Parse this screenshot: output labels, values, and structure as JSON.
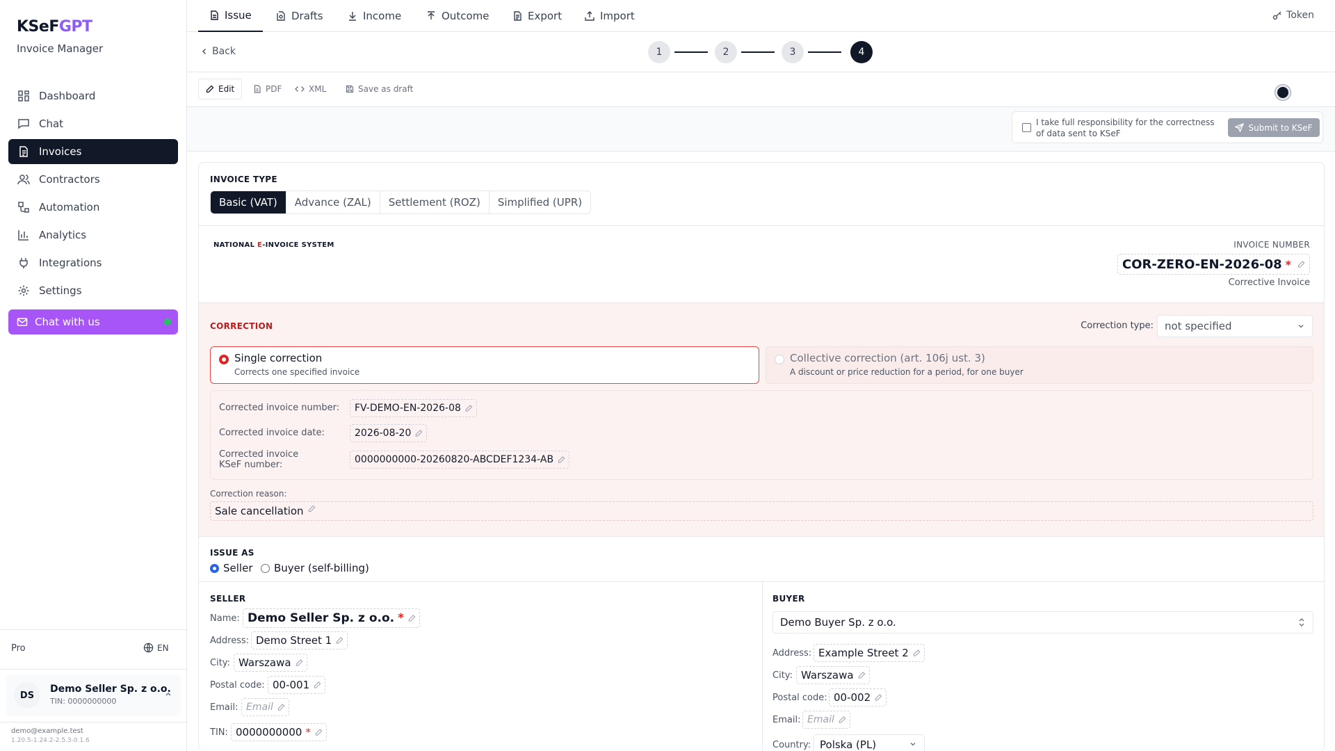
{
  "sidebar": {
    "brand": {
      "prefix": "KSeF",
      "suffix": "GPT"
    },
    "subtitle": "Invoice Manager",
    "nav": [
      {
        "label": "Dashboard",
        "icon": "dashboard-icon"
      },
      {
        "label": "Chat",
        "icon": "chat-icon"
      },
      {
        "label": "Invoices",
        "icon": "invoice-icon"
      },
      {
        "label": "Contractors",
        "icon": "users-icon"
      },
      {
        "label": "Automation",
        "icon": "workflow-icon"
      },
      {
        "label": "Analytics",
        "icon": "bar-chart-icon"
      },
      {
        "label": "Integrations",
        "icon": "plug-icon"
      },
      {
        "label": "Settings",
        "icon": "gear-icon"
      }
    ],
    "active_nav": "Invoices",
    "chat_button": "Chat with us",
    "plan": "Pro",
    "language": "EN",
    "user": {
      "initials": "DS",
      "name": "Demo Seller Sp. z o.o.",
      "tin": "TIN: 0000000000"
    },
    "email": "demo@example.test",
    "version": "1.20.5-1.24.2-2.5.3-0.1.6"
  },
  "topbar": {
    "tabs": [
      {
        "label": "Issue",
        "icon": "file-icon"
      },
      {
        "label": "Drafts",
        "icon": "drafts-icon"
      },
      {
        "label": "Income",
        "icon": "download-icon"
      },
      {
        "label": "Outcome",
        "icon": "upload-icon"
      },
      {
        "label": "Export",
        "icon": "file-text-icon"
      },
      {
        "label": "Import",
        "icon": "import-icon"
      }
    ],
    "active_tab": "Issue",
    "token": "Token"
  },
  "stepper": {
    "back": "Back",
    "steps": [
      "1",
      "2",
      "3",
      "4"
    ],
    "current_step": "4"
  },
  "toolbar": {
    "edit": "Edit",
    "pdf": "PDF",
    "xml": "XML",
    "save_draft": "Save as draft"
  },
  "submit": {
    "consent_text": "I take full responsibility for the correctness of data sent to KSeF",
    "button": "Submit to KSeF"
  },
  "invoice_type": {
    "title": "INVOICE TYPE",
    "options": [
      "Basic (VAT)",
      "Advance (ZAL)",
      "Settlement (ROZ)",
      "Simplified (UPR)"
    ],
    "selected": "Basic (VAT)"
  },
  "header": {
    "system_prefix": "NATIONAL ",
    "system_e": "E",
    "system_suffix": "-INVOICE SYSTEM",
    "invoice_number_label": "INVOICE NUMBER",
    "invoice_number": "COR-ZERO-EN-2026-08",
    "required_mark": "*",
    "invoice_kind": "Corrective Invoice"
  },
  "correction": {
    "title": "CORRECTION",
    "type_label": "Correction type:",
    "type_value": "not specified",
    "single": {
      "title": "Single correction",
      "desc": "Corrects one specified invoice"
    },
    "collective": {
      "title": "Collective correction (art. 106j ust. 3)",
      "desc": "A discount or price reduction for a period, for one buyer"
    },
    "selected": "single",
    "fields": {
      "number_label": "Corrected invoice number:",
      "number": "FV-DEMO-EN-2026-08",
      "date_label": "Corrected invoice date:",
      "date": "2026-08-20",
      "ksef_label": "Corrected invoice KSeF number:",
      "ksef": "0000000000-20260820-ABCDEF1234-AB"
    },
    "reason_label": "Correction reason:",
    "reason": "Sale cancellation"
  },
  "issue_as": {
    "title": "ISSUE AS",
    "options": [
      "Seller",
      "Buyer (self-billing)"
    ],
    "selected": "Seller"
  },
  "seller": {
    "title": "SELLER",
    "name_label": "Name:",
    "name": "Demo Seller Sp. z o.o.",
    "address_label": "Address:",
    "address": "Demo Street 1",
    "city_label": "City:",
    "city": "Warszawa",
    "postal_label": "Postal code:",
    "postal": "00-001",
    "email_label": "Email:",
    "email_placeholder": "Email",
    "tin_label": "TIN:",
    "tin": "0000000000"
  },
  "buyer": {
    "title": "BUYER",
    "selected": "Demo Buyer Sp. z o.o.",
    "address_label": "Address:",
    "address": "Example Street 2",
    "city_label": "City:",
    "city": "Warszawa",
    "postal_label": "Postal code:",
    "postal": "00-002",
    "email_label": "Email:",
    "email_placeholder": "Email",
    "country_label": "Country:",
    "country": "Polska (PL)"
  }
}
